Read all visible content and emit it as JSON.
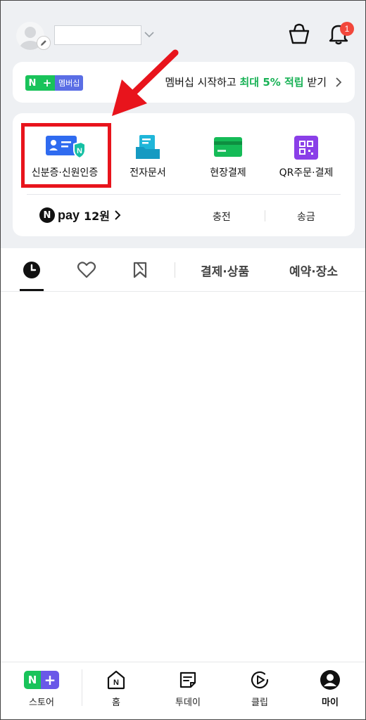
{
  "header": {
    "notification_count": "1"
  },
  "banner": {
    "logo_n": "N",
    "logo_plus": "+",
    "logo_text": "멤버십",
    "text_prefix": "멤버십 시작하고 ",
    "text_highlight": "최대 5% 적립",
    "text_suffix": " 받기"
  },
  "quick_menu": {
    "items": [
      {
        "label": "신분증·신원인증",
        "icon": "id-card-shield-icon"
      },
      {
        "label": "전자문서",
        "icon": "document-folder-icon"
      },
      {
        "label": "현장결제",
        "icon": "card-payment-icon"
      },
      {
        "label": "QR주문·결제",
        "icon": "qr-code-icon"
      }
    ]
  },
  "pay": {
    "logo_n": "N",
    "word": "pay",
    "amount": "12원",
    "charge_label": "충전",
    "send_label": "송금"
  },
  "tabs": {
    "icons": [
      "clock-icon",
      "heart-icon",
      "bookmark-icon"
    ],
    "text_tabs": [
      "결제·상품",
      "예약·장소"
    ]
  },
  "bottom_nav": {
    "items": [
      {
        "label": "스토어",
        "icon": "store-logo-icon"
      },
      {
        "label": "홈",
        "icon": "home-icon"
      },
      {
        "label": "투데이",
        "icon": "today-icon"
      },
      {
        "label": "클립",
        "icon": "clip-play-icon"
      },
      {
        "label": "마이",
        "icon": "profile-icon"
      }
    ],
    "store_logo_n": "N",
    "store_logo_plus": "+",
    "active": "마이"
  },
  "colors": {
    "accent_green": "#19c35a",
    "highlight_red": "#e8141c",
    "badge_red": "#f2473b",
    "purple": "#6a58e8"
  }
}
